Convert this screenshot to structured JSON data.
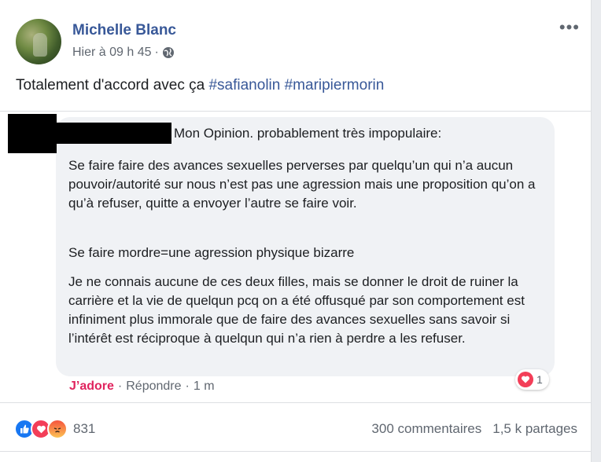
{
  "post": {
    "author": "Michelle Blanc",
    "time": "Hier à 09 h 45",
    "dot": "·",
    "more": "•••",
    "text_prefix": "Totalement d'accord avec ça ",
    "hashtags": [
      "#safianolin",
      "#maripiermorin"
    ]
  },
  "comment": {
    "heading": "Mon Opinion. probablement très impopulaire:",
    "paragraphs": [
      "Se faire faire des avances sexuelles perverses par quelqu’un qui n’a aucun pouvoir/autorité sur nous n’est pas une agression mais une proposition qu’on a qu’à refuser, quitte a envoyer l’autre se faire voir.",
      "Se faire mordre=une agression physique bizarre",
      "Je ne connais aucune de ces deux filles, mais se donner le droit de ruiner la carrière et la vie de quelqun pcq on a été offusqué par son comportement est infiniment plus immorale que de faire des avances sexuelles sans savoir si l’intérêt est réciproque à quelqun qui n’a rien à perdre a les refuser."
    ],
    "actions": {
      "love": "J’adore",
      "reply": "Répondre",
      "sep": "·",
      "time": "1 m"
    },
    "reaction_count": "1"
  },
  "summary": {
    "reaction_total": "831",
    "comments": "300 commentaires",
    "shares": "1,5 k partages"
  },
  "colors": {
    "link": "#385898",
    "love": "#f33e58",
    "like": "#1877f2"
  }
}
